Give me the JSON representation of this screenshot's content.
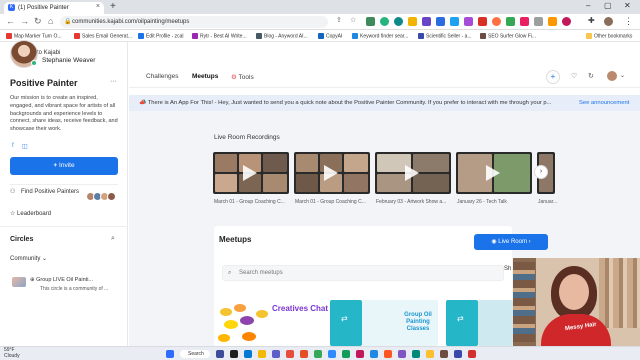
{
  "browser": {
    "tab_title": "(1) Positive Painter",
    "url": "communities.kajabi.com/oilpainting/meetups",
    "bookmarks": [
      "Map Marker Turn O...",
      "Sales Email Generat...",
      "Edit Profile - zcal",
      "Rytr - Best AI Write...",
      "Blog - Anyword AI...",
      "CopyAI",
      "Keyword finder sear...",
      "Scientific Seller - a...",
      "SEO Surfer Glow Fi..."
    ],
    "bookmark_colors": [
      "#e53935",
      "#e53935",
      "#1a73e8",
      "#9c27b0",
      "#455a64",
      "#1565c0",
      "#1e88e5",
      "#3949ab",
      "#6d4c41"
    ],
    "other_bookmarks": "Other bookmarks"
  },
  "sidebar": {
    "back": "Back to Kajabi",
    "user_name": "Stephanie Weaver",
    "community_title": "Positive Painter",
    "description": "Our mission is to create an inspired, engaged, and vibrant space for artists of all backgrounds and experience levels to connect, share ideas, receive feedback, and showcase their work.",
    "invite": "Invite",
    "find_label": "Find Positive Painters",
    "leaderboard": "Leaderboard",
    "circles_title": "Circles",
    "community_dropdown": "Community",
    "group_name": "Group LIVE Oil Painti...",
    "group_desc": "This circle is a community of ..."
  },
  "header": {
    "tabs": [
      "Challenges",
      "Meetups",
      "Tools"
    ],
    "active_tab": "Meetups"
  },
  "announcement": {
    "text": "There is An App For This! - Hey, Just wanted to send you a quick note about the Positive Painter Community. If you prefer to interact with me through your p...",
    "link": "See announcement"
  },
  "recordings": {
    "title": "Live Room Recordings",
    "items": [
      {
        "caption": "March 01 - Group Coaching C..."
      },
      {
        "caption": "March 01 - Group Coaching C..."
      },
      {
        "caption": "February 03 - Artwork Show a..."
      },
      {
        "caption": "January 26 - Tech Talk"
      },
      {
        "caption": "Januar..."
      }
    ]
  },
  "meetups": {
    "title": "Meetups",
    "live_room": "Live Room",
    "search_placeholder": "Search meetups",
    "sort": "Sh",
    "card1_text": "Creatives Chat",
    "card2_text": "Group Oil Painting Classes"
  },
  "taskbar": {
    "weather_temp": "59°F",
    "weather_desc": "Cloudy",
    "search": "Search"
  }
}
